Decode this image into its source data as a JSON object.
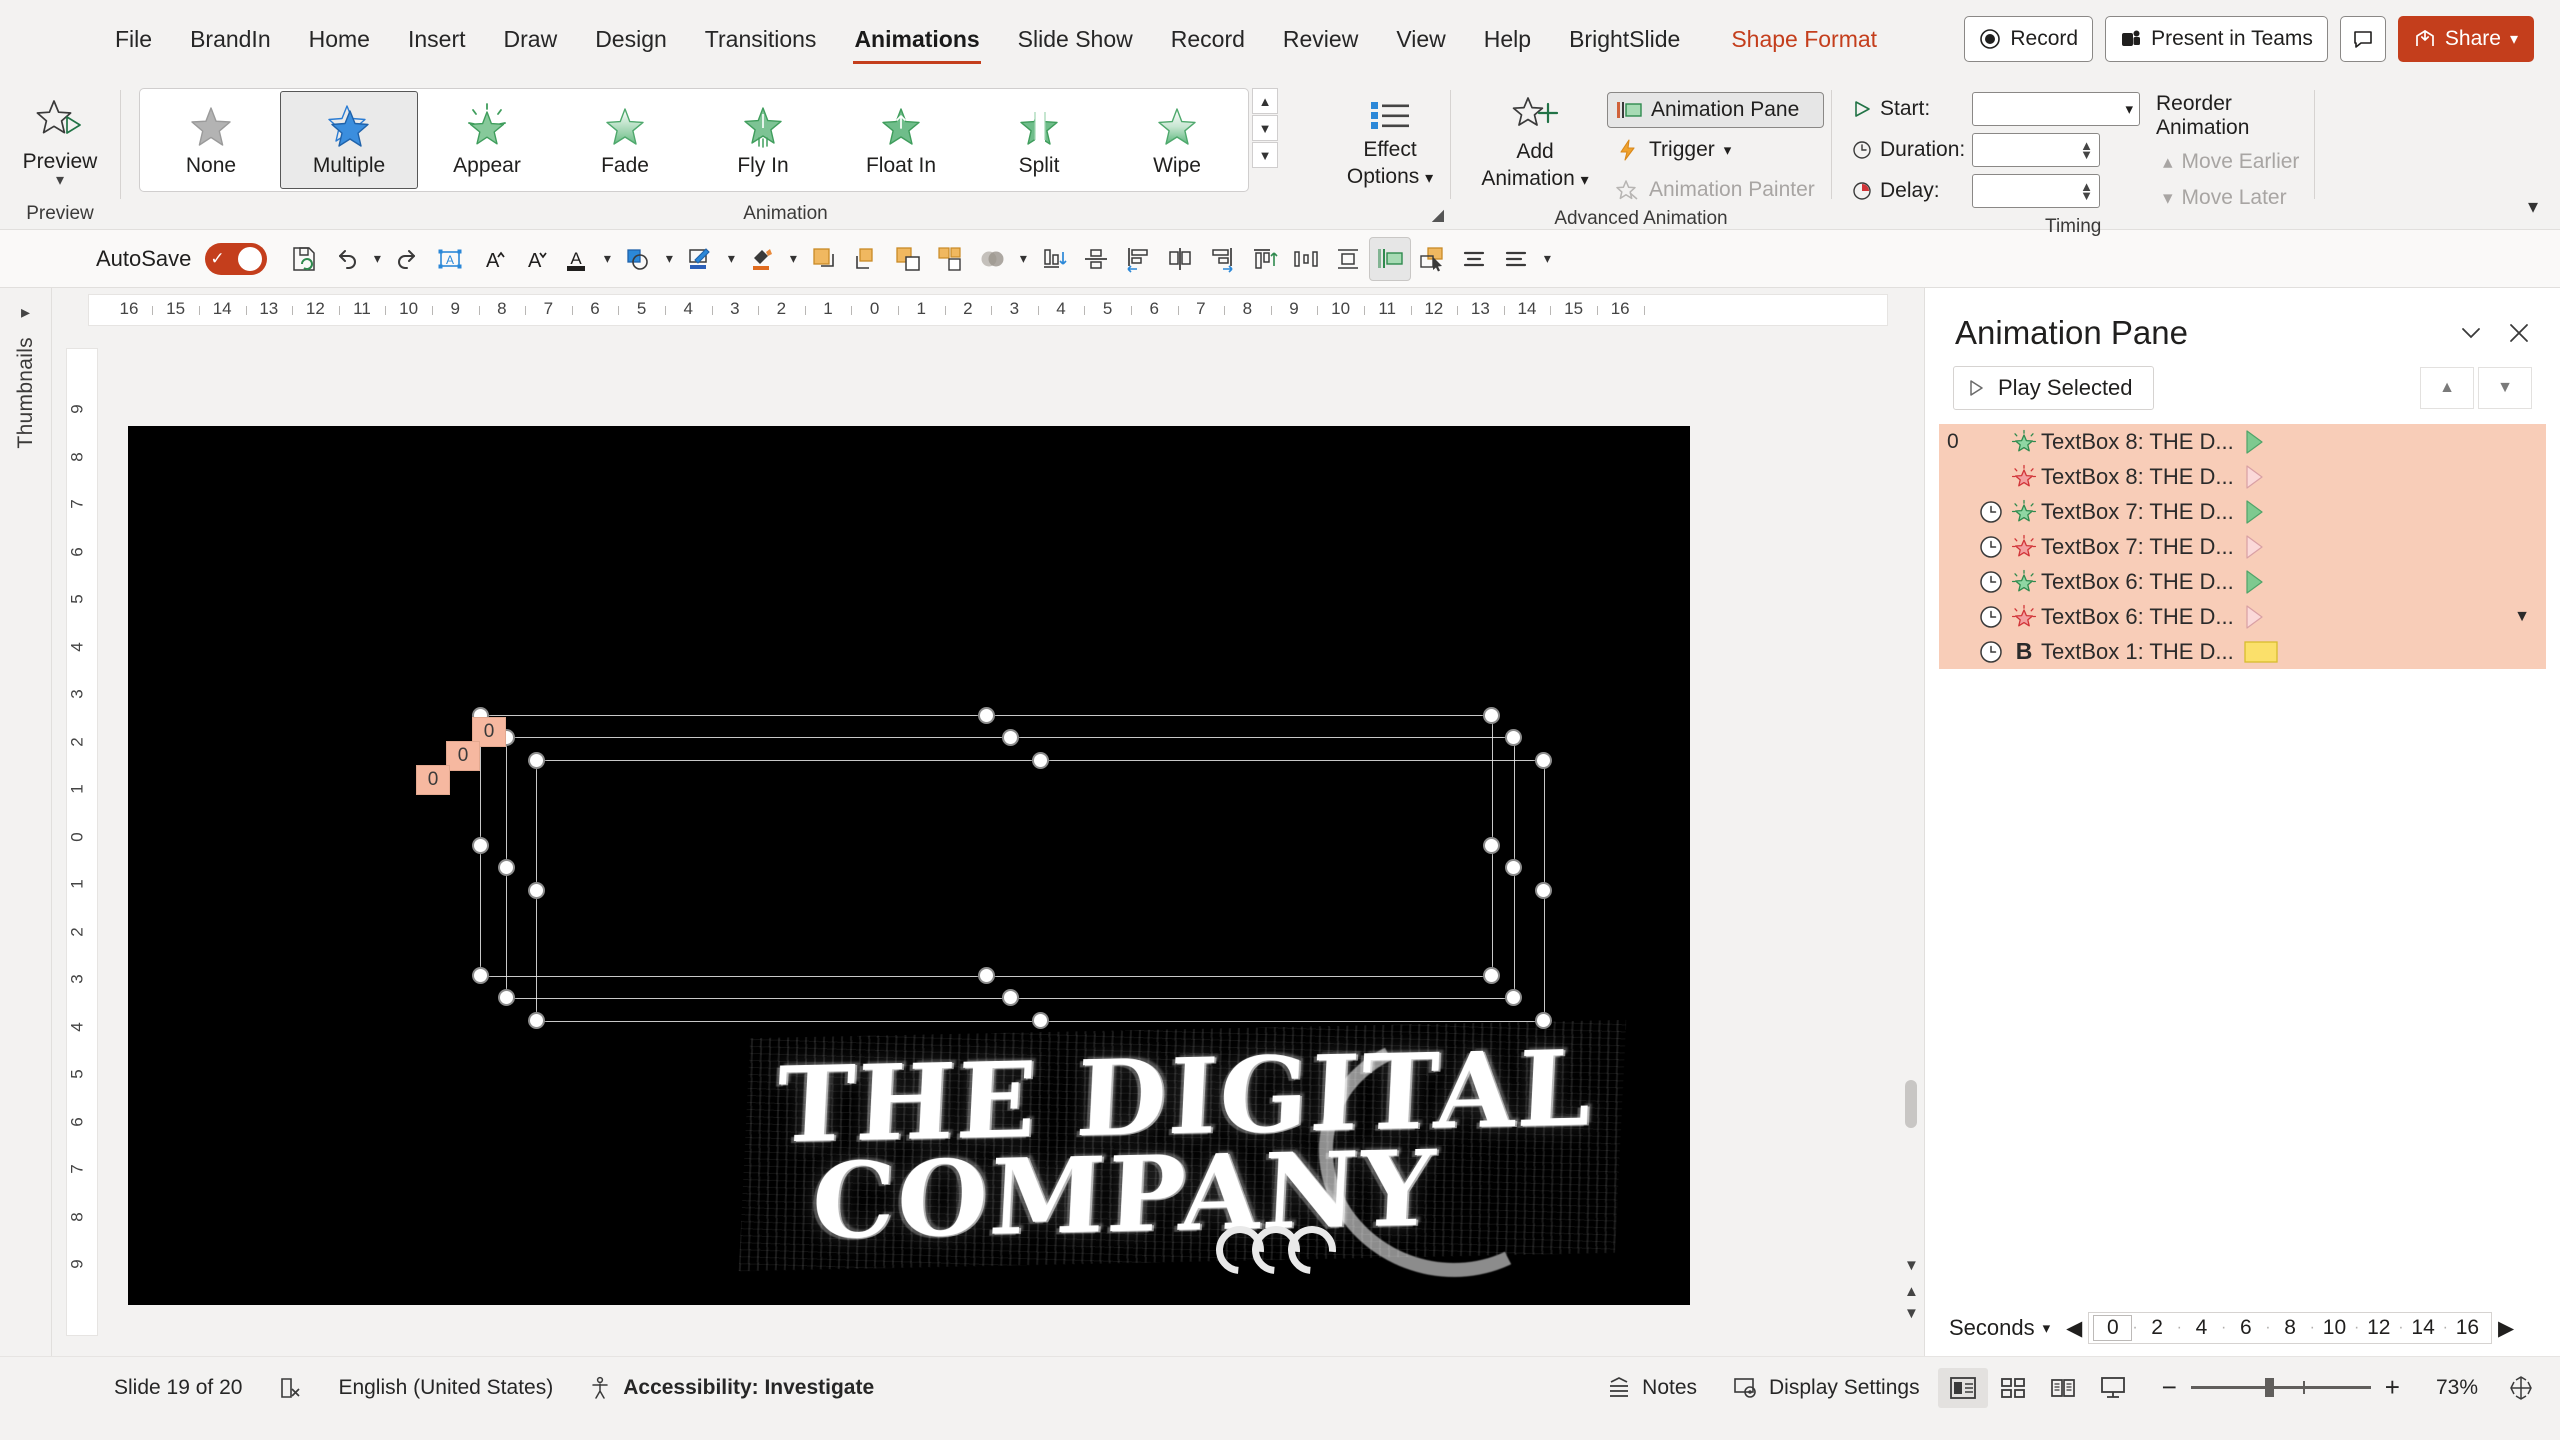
{
  "app": {
    "context_tab": "Shape Format"
  },
  "menu": {
    "items": [
      {
        "label": "File",
        "active": false
      },
      {
        "label": "BrandIn",
        "active": false
      },
      {
        "label": "Home",
        "active": false
      },
      {
        "label": "Insert",
        "active": false
      },
      {
        "label": "Draw",
        "active": false
      },
      {
        "label": "Design",
        "active": false
      },
      {
        "label": "Transitions",
        "active": false
      },
      {
        "label": "Animations",
        "active": true
      },
      {
        "label": "Slide Show",
        "active": false
      },
      {
        "label": "Record",
        "active": false
      },
      {
        "label": "Review",
        "active": false
      },
      {
        "label": "View",
        "active": false
      },
      {
        "label": "Help",
        "active": false
      },
      {
        "label": "BrightSlide",
        "active": false
      }
    ],
    "record_button": "Record",
    "present_in_teams_button": "Present in Teams",
    "share_button": "Share",
    "accent_color": "#c43e1c"
  },
  "ribbon": {
    "preview": {
      "label": "Preview",
      "group_label": "Preview"
    },
    "animation_group_label": "Animation",
    "gallery": [
      {
        "label": "None",
        "style": "gray",
        "selected": false
      },
      {
        "label": "Multiple",
        "style": "blue",
        "selected": true
      },
      {
        "label": "Appear",
        "style": "green-burst",
        "selected": false
      },
      {
        "label": "Fade",
        "style": "green-fade",
        "selected": false
      },
      {
        "label": "Fly In",
        "style": "green-fly",
        "selected": false
      },
      {
        "label": "Float In",
        "style": "green-float",
        "selected": false
      },
      {
        "label": "Split",
        "style": "green-split",
        "selected": false
      },
      {
        "label": "Wipe",
        "style": "green-wipe",
        "selected": false
      }
    ],
    "effect_options": {
      "line1": "Effect",
      "line2": "Options"
    },
    "advanced": {
      "group_label": "Advanced Animation",
      "add_animation_line1": "Add",
      "add_animation_line2": "Animation",
      "animation_pane": "Animation Pane",
      "trigger": "Trigger",
      "animation_painter": "Animation Painter"
    },
    "timing": {
      "group_label": "Timing",
      "start_label": "Start:",
      "start_value": "",
      "duration_label": "Duration:",
      "duration_value": "",
      "delay_label": "Delay:",
      "delay_value": "",
      "reorder_header": "Reorder Animation",
      "move_earlier": "Move Earlier",
      "move_later": "Move Later"
    }
  },
  "quick_access": {
    "autosave_label": "AutoSave",
    "autosave_on": true,
    "icons": [
      {
        "name": "save-refresh-icon",
        "caret": false
      },
      {
        "name": "undo-icon",
        "caret": true
      },
      {
        "name": "redo-icon",
        "caret": false
      },
      {
        "name": "text-box-icon",
        "caret": false
      },
      {
        "name": "increase-font-size-icon",
        "caret": false
      },
      {
        "name": "decrease-font-size-icon",
        "caret": false
      },
      {
        "name": "font-color-icon",
        "caret": true
      },
      {
        "name": "shape-fill-icon",
        "caret": true
      },
      {
        "name": "shape-outline-icon",
        "caret": true
      },
      {
        "name": "format-painter-icon",
        "caret": true
      },
      {
        "name": "bring-to-front-icon",
        "caret": false
      },
      {
        "name": "bring-forward-icon",
        "caret": false
      },
      {
        "name": "send-backward-icon",
        "caret": false
      },
      {
        "name": "send-to-back-icon",
        "caret": false
      },
      {
        "name": "merge-shapes-icon",
        "caret": true
      },
      {
        "name": "align-bottom-icon",
        "caret": false
      },
      {
        "name": "align-middle-icon",
        "caret": false
      },
      {
        "name": "align-left-icon",
        "caret": false
      },
      {
        "name": "align-center-icon",
        "caret": false
      },
      {
        "name": "align-right-icon",
        "caret": false
      },
      {
        "name": "align-top-icon",
        "caret": false
      },
      {
        "name": "distribute-horizontal-icon",
        "caret": false
      },
      {
        "name": "distribute-vertical-icon",
        "caret": false
      },
      {
        "name": "animation-pane-icon",
        "caret": false,
        "toggled": true
      },
      {
        "name": "selection-pane-icon",
        "caret": false
      },
      {
        "name": "align-text-left-icon",
        "caret": false
      },
      {
        "name": "align-text-center-icon",
        "caret": false
      },
      {
        "name": "overflow-caret-icon",
        "caret": false
      }
    ]
  },
  "rail": {
    "thumbnails_label": "Thumbnails"
  },
  "rulers": {
    "horizontal": [
      "16",
      "15",
      "14",
      "13",
      "12",
      "11",
      "10",
      "9",
      "8",
      "7",
      "6",
      "5",
      "4",
      "3",
      "2",
      "1",
      "0",
      "1",
      "2",
      "3",
      "4",
      "5",
      "6",
      "7",
      "8",
      "9",
      "10",
      "11",
      "12",
      "13",
      "14",
      "15",
      "16"
    ],
    "vertical": [
      "9",
      "8",
      "7",
      "6",
      "5",
      "4",
      "3",
      "2",
      "1",
      "0",
      "1",
      "2",
      "3",
      "4",
      "5",
      "6",
      "7",
      "8",
      "9"
    ]
  },
  "slide": {
    "background_color": "#000000",
    "headline_line1": "THE DIGITAL",
    "headline_line2": "COMPANY",
    "selection_tags": [
      "0",
      "0",
      "0"
    ]
  },
  "animation_pane": {
    "title": "Animation Pane",
    "play_selected": "Play Selected",
    "items": [
      {
        "index": "0",
        "clock": false,
        "effect": "entrance-star",
        "effect_color": "green",
        "name": "TextBox 8: THE D...",
        "bar": "green-arrow"
      },
      {
        "index": "",
        "clock": false,
        "effect": "exit-star",
        "effect_color": "red",
        "name": "TextBox 8: THE D...",
        "bar": "pink-arrow"
      },
      {
        "index": "",
        "clock": true,
        "effect": "entrance-star",
        "effect_color": "green",
        "name": "TextBox 7: THE D...",
        "bar": "green-arrow"
      },
      {
        "index": "",
        "clock": true,
        "effect": "exit-star",
        "effect_color": "red",
        "name": "TextBox 7: THE D...",
        "bar": "pink-arrow"
      },
      {
        "index": "",
        "clock": true,
        "effect": "entrance-star",
        "effect_color": "green",
        "name": "TextBox 6: THE D...",
        "bar": "green-arrow"
      },
      {
        "index": "",
        "clock": true,
        "effect": "exit-star",
        "effect_color": "red",
        "name": "TextBox 6: THE D...",
        "bar": "pink-arrow"
      },
      {
        "index": "",
        "clock": true,
        "effect": "bold-b",
        "effect_color": "black",
        "name": "TextBox 1: THE D...",
        "bar": "yellow-block"
      }
    ],
    "selection_color": "#f8cdb8",
    "seconds_label": "Seconds",
    "timeline_ticks": [
      "0",
      "2",
      "4",
      "6",
      "8",
      "10",
      "12",
      "14",
      "16"
    ]
  },
  "status_bar": {
    "slide_counter": "Slide 19 of 20",
    "language": "English (United States)",
    "accessibility": "Accessibility: Investigate",
    "notes": "Notes",
    "display_settings": "Display Settings",
    "zoom_percent": "73%"
  }
}
